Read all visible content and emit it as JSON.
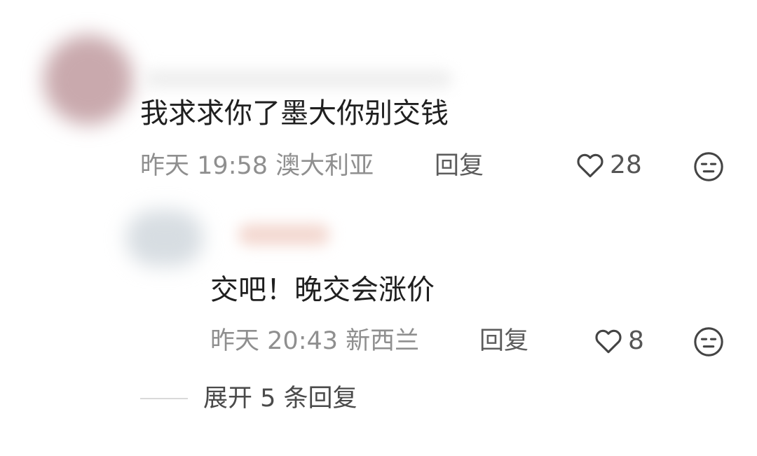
{
  "comments": [
    {
      "text": "我求求你了墨大你别交钱",
      "date": "昨天",
      "time": "19:58",
      "location": "澳大利亚",
      "reply_label": "回复",
      "likes": "28",
      "avatar_color": "#c9a9ad",
      "name_color": "#e6e6e6"
    },
    {
      "text": "交吧！晚交会涨价",
      "date": "昨天",
      "time": "20:43",
      "location": "新西兰",
      "reply_label": "回复",
      "likes": "8",
      "avatar_color": "#d7dde2",
      "name_color": "#f3d7cf"
    }
  ],
  "expand": {
    "label": "展开 5 条回复"
  },
  "colors": {
    "text_primary": "#1f1f1f",
    "text_meta": "#8f8f8f",
    "icon": "#444444"
  },
  "icons": [
    "heart-icon",
    "dislike-face-icon"
  ]
}
